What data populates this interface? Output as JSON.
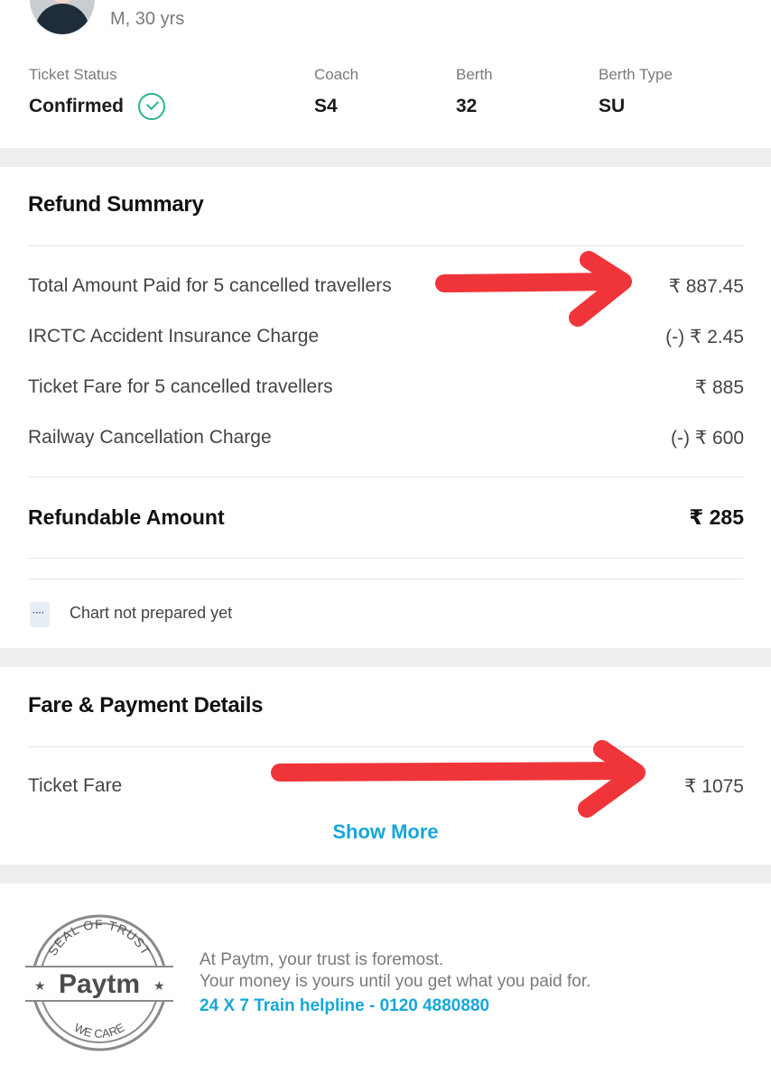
{
  "passenger": {
    "meta": "M, 30 yrs"
  },
  "ticket_info": {
    "status_label": "Ticket Status",
    "status_value": "Confirmed",
    "coach_label": "Coach",
    "coach_value": "S4",
    "berth_label": "Berth",
    "berth_value": "32",
    "berth_type_label": "Berth Type",
    "berth_type_value": "SU"
  },
  "refund_summary": {
    "title": "Refund Summary",
    "rows": [
      {
        "label": "Total Amount Paid for 5 cancelled travellers",
        "value": "₹ 887.45"
      },
      {
        "label": "IRCTC Accident Insurance Charge",
        "value": "(-) ₹ 2.45"
      },
      {
        "label": "Ticket Fare for 5 cancelled travellers",
        "value": "₹ 885"
      },
      {
        "label": "Railway Cancellation Charge",
        "value": "(-) ₹ 600"
      }
    ],
    "total_label": "Refundable Amount",
    "total_value": "₹ 285",
    "note": "Chart not prepared yet"
  },
  "fare_details": {
    "title": "Fare & Payment Details",
    "ticket_fare_label": "Ticket Fare",
    "ticket_fare_value": "₹ 1075",
    "show_more": "Show More"
  },
  "footer": {
    "seal_top": "SEAL OF TRUST",
    "seal_brand": "Paytm",
    "seal_bottom": "WE CARE",
    "line1": "At Paytm, your trust is foremost.",
    "line2": "Your money is yours until you get what you paid for.",
    "helpline": "24 X 7 Train helpline - 0120 4880880"
  },
  "colors": {
    "accent": "#16a7d9",
    "confirmed_green": "#2bb48f",
    "annotation_red": "#f0353a",
    "section_gap": "#eeeeee"
  }
}
